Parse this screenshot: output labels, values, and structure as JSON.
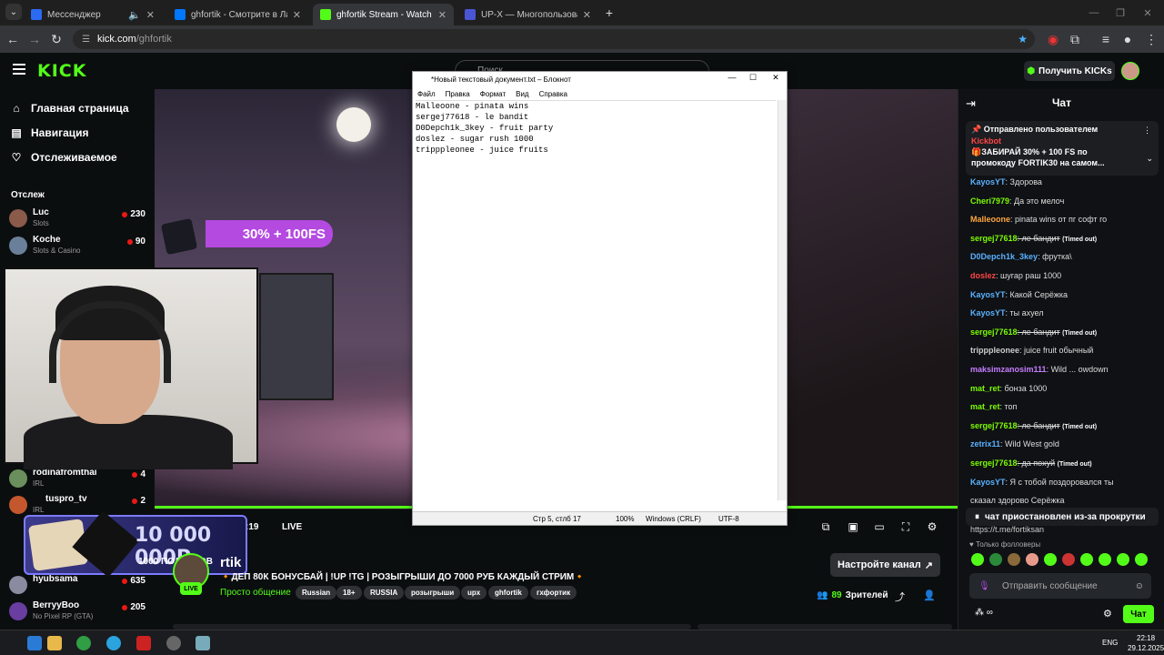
{
  "browser": {
    "tabs": [
      {
        "title": "Мессенджер",
        "color": "#2a6bf2",
        "active": false
      },
      {
        "title": "ghfortik - Смотрите в Лайве н",
        "color": "#0077ff",
        "active": false
      },
      {
        "title": "ghfortik Stream - Watch Live o",
        "color": "#53fc18",
        "active": true
      },
      {
        "title": "UP-X — Многопользователь",
        "color": "#4a55d6",
        "active": false
      }
    ],
    "url_host": "kick.com",
    "url_path": "/ghfortik"
  },
  "kick": {
    "logo": "KICK",
    "get_kicks": "Получить KICKs",
    "search_placeholder": "Поиск"
  },
  "sidebar": {
    "nav": [
      {
        "label": "Главная страница"
      },
      {
        "label": "Навигация"
      },
      {
        "label": "Отслеживаемое"
      }
    ],
    "section": "Отслеж",
    "channels": [
      {
        "name": "Luc",
        "cat": "Slots",
        "viewers": "230",
        "color": "#8a5a4a"
      },
      {
        "name": "Koche",
        "cat": "Slots & Casino",
        "viewers": "90",
        "color": "#6a7f99"
      },
      {
        "name": "rodinafromthai",
        "cat": "IRL",
        "viewers": "4",
        "color": "#6b8f5c"
      },
      {
        "name": "tuspro_tv",
        "cat": "IRL",
        "viewers": "2",
        "color": "#c4572d"
      },
      {
        "name": "hyubsama",
        "cat": "",
        "viewers": "635",
        "color": "#8a8aa0"
      },
      {
        "name": "BerryyBoo",
        "cat": "No Pixel RP (GTA)",
        "viewers": "205",
        "color": "#6a3da0"
      }
    ]
  },
  "video": {
    "promo_text": "30% + 100FS",
    "time": ":19",
    "live_label": "LIVE"
  },
  "gifts": {
    "big": "10 000 000Р",
    "small": "1000 ПОДАРКОВ"
  },
  "stream": {
    "channel": "rtik",
    "title": "🔸ДЕП 80К БОНУСБАЙ | !UP !TG | РОЗЫГРЫШИ ДО 7000 РУБ КАЖДЫЙ СТРИМ🔸",
    "category": "Просто общение",
    "tags": [
      "Russian",
      "18+",
      "RUSSIA",
      "розыгрыши",
      "upx",
      "ghfortik",
      "гхфортик"
    ],
    "live_badge": "LIVE",
    "setup_btn": "Настройте канал",
    "viewers": "89",
    "viewers_label": "Зрителей"
  },
  "chat": {
    "title": "Чат",
    "pinned_header": "Отправлено пользователем",
    "pinned_user": "Kickbot",
    "pinned_line1": "🎁ЗАБИРАЙ 30% + 100 FS по",
    "pinned_line2": "промокоду FORTIK30 на самом...",
    "messages": [
      {
        "user": "KayosYT",
        "color": "#5ab1ff",
        "text": ": Здорова",
        "timeout": false
      },
      {
        "user": "Cheri7979",
        "color": "#7cfc00",
        "text": ": Да это мелоч",
        "timeout": false
      },
      {
        "user": "Malleoone",
        "color": "#ffa640",
        "text": ": pinata wins от пг софт го",
        "timeout": false
      },
      {
        "user": "sergej77618",
        "color": "#7cfc00",
        "text": ": ле бандит",
        "timeout": true
      },
      {
        "user": "D0Depch1k_3key",
        "color": "#5ab1ff",
        "text": ": фрутка\\",
        "timeout": false
      },
      {
        "user": "doslez",
        "color": "#ff4545",
        "text": ": шугар раш 1000",
        "timeout": false
      },
      {
        "user": "KayosYT",
        "color": "#5ab1ff",
        "text": ": Какой Серёжка",
        "timeout": false
      },
      {
        "user": "KayosYT",
        "color": "#5ab1ff",
        "text": ": ты ахуел",
        "timeout": false
      },
      {
        "user": "sergej77618",
        "color": "#7cfc00",
        "text": ": ле бандит",
        "timeout": true
      },
      {
        "user": "tripppleonee",
        "color": "#cccccc",
        "text": ": juice fruit обычный",
        "timeout": false
      },
      {
        "user": "maksimzanosim111",
        "color": "#c77dff",
        "text": ": Wild ... owdown",
        "timeout": false
      },
      {
        "user": "mat_ret",
        "color": "#7cfc00",
        "text": ": бонза 1000",
        "timeout": false
      },
      {
        "user": "mat_ret",
        "color": "#7cfc00",
        "text": ": топ",
        "timeout": false
      },
      {
        "user": "sergej77618",
        "color": "#7cfc00",
        "text": ": ле бандит",
        "timeout": true
      },
      {
        "user": "zetrix11",
        "color": "#5ab1ff",
        "text": ": Wild West gold",
        "timeout": false
      },
      {
        "user": "sergej77618",
        "color": "#7cfc00",
        "text": ": да похуй",
        "timeout": true
      },
      {
        "user": "KayosYT",
        "color": "#5ab1ff",
        "text": ": Я с тобой поздоровался ты",
        "timeout": false
      },
      {
        "user": "",
        "color": "#ffffff",
        "text": "сказал здорово Серёжка",
        "timeout": false
      }
    ],
    "timeout_label": "(Timed out)",
    "paused": "чат приостановлен из-за прокрутки",
    "link": "https://t.me/fortiksan",
    "followers_only": "Только фолловеры",
    "input_placeholder": "Отправить сообщение",
    "send_btn": "Чат"
  },
  "notepad": {
    "title": "*Новый текстовый документ.txt – Блокнот",
    "menu": [
      "Файл",
      "Правка",
      "Формат",
      "Вид",
      "Справка"
    ],
    "content": "Malleoone - pinata wins\nsergej77618 - le bandit\nD0Depch1k_3key - fruit party\ndoslez - sugar rush 1000\ntripppleonee - juice fruits",
    "status_pos": "Стр 5, стлб 17",
    "status_zoom": "100%",
    "status_eol": "Windows (CRLF)",
    "status_enc": "UTF-8"
  },
  "taskbar": {
    "lang": "ENG",
    "time": "22:18",
    "date": "29.12.2025"
  }
}
